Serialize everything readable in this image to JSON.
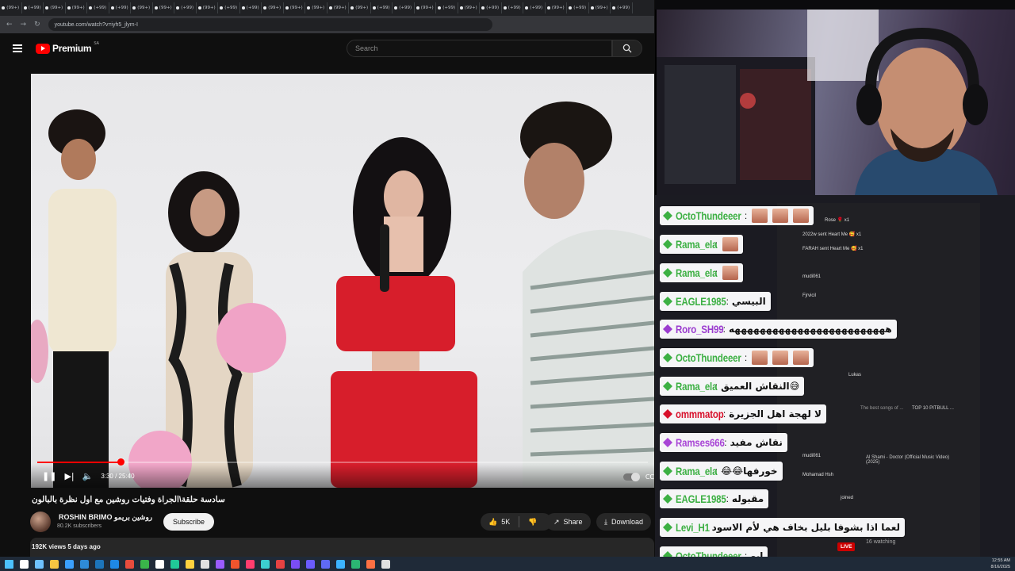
{
  "browser": {
    "tab_labels": [
      "(99+)",
      "(+99)",
      "(99+)",
      "(99+)",
      "(+99)",
      "(+99)",
      "(99+)",
      "(99+)",
      "(+99)",
      "(99+)",
      "(+99)",
      "(+99)",
      "(99+)",
      "(99+)",
      "(99+)",
      "(99+)",
      "(99+)",
      "(+99)",
      "(+99)",
      "(99+)",
      "(+99)",
      "(99+)",
      "(+99)",
      "(+99)",
      "(+99)",
      "(99+)",
      "(+99)",
      "(99+)",
      "(+99)"
    ],
    "url": "youtube.com/watch?v=iyh5_jlym-I"
  },
  "youtube": {
    "logo_text": "Premium",
    "logo_sup": "SA",
    "search_placeholder": "Search",
    "player": {
      "time_label": "3:30 / 25:40",
      "progress_fraction": 0.1364
    },
    "video_title": "سادسة حلقة\\الجراة وفتيات روشين مع اول نظرة بالبالون",
    "channel": {
      "name": "ROSHIN BRIMO روشين بريمو",
      "subscribers": "80.2K subscribers",
      "subscribe_label": "Subscribe"
    },
    "actions": {
      "likes": "5K",
      "share": "Share",
      "download": "Download"
    },
    "views_date": "192K views  5 days ago"
  },
  "stream": {
    "chat": [
      {
        "user": "OctoThundeeer",
        "color": "#3cb043",
        "message": "",
        "emotes": 3
      },
      {
        "user": "Rama_ela",
        "color": "#3cb043",
        "message": "",
        "emotes": 1
      },
      {
        "user": "Rama_ela",
        "color": "#3cb043",
        "message": "",
        "emotes": 1
      },
      {
        "user": "EAGLE1985",
        "color": "#3cb043",
        "message": "البيسي",
        "emotes": 0
      },
      {
        "user": "Roro_SH99",
        "color": "#9b3ccf",
        "message": "هههههههههههههههههههههههههه",
        "emotes": 0
      },
      {
        "user": "OctoThundeeer",
        "color": "#3cb043",
        "message": "",
        "emotes": 3
      },
      {
        "user": "Rama_ela",
        "color": "#3cb043",
        "message": "النقاش العميق😅",
        "emotes": 0
      },
      {
        "user": "ommmatop",
        "color": "#d8102b",
        "message": "لا لهجة اهل الجزيرة",
        "emotes": 0
      },
      {
        "user": "Ramses666",
        "color": "#a845d6",
        "message": "نقاش مفيد",
        "emotes": 0
      },
      {
        "user": "Rama_ela",
        "color": "#3cb043",
        "message": "😂😂خورفها",
        "emotes": 0
      },
      {
        "user": "EAGLE1985",
        "color": "#3cb043",
        "message": "مقبوله",
        "emotes": 0
      },
      {
        "user": "Levi_H1",
        "color": "#3cb043",
        "message": "لعما اذا بشوفا بليل بخاف هي لأم الاسود",
        "emotes": 0
      },
      {
        "user": "OctoThundeeer",
        "color": "#3cb043",
        "message": "ابو",
        "emotes": 0
      }
    ],
    "side_panel": {
      "events": [
        "Rose 🌹 x1",
        "2022w sent Heart Me 🥰 x1",
        "FARAH sent Heart Me 🥰 x1",
        "mudi061",
        "Fjrvicil",
        "Lukas",
        "mudi061",
        "Mohamad Hsh",
        "joined"
      ],
      "video_titles": [
        "TOP 10 PITBULL ...",
        "The best songs of ...",
        "Al Shami - Doctor (Official Music Video) (2025)"
      ],
      "live_label": "LIVE",
      "watching": "16 watching"
    }
  },
  "taskbar": {
    "time": "12:55 AM",
    "date": "8/16/2025"
  }
}
